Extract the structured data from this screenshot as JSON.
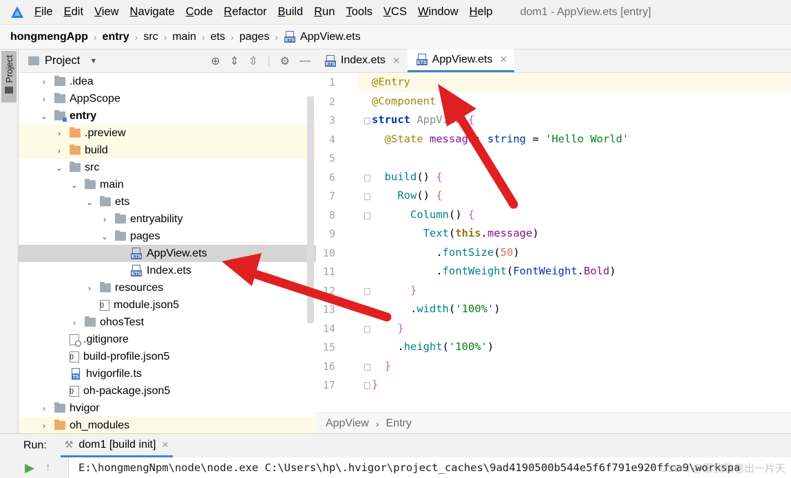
{
  "menubar": {
    "items": [
      {
        "underline": "F",
        "rest": "ile"
      },
      {
        "underline": "E",
        "rest": "dit"
      },
      {
        "underline": "V",
        "rest": "iew"
      },
      {
        "underline": "N",
        "rest": "avigate"
      },
      {
        "underline": "C",
        "rest": "ode"
      },
      {
        "underline": "R",
        "rest": "efactor"
      },
      {
        "underline": "B",
        "rest": "uild"
      },
      {
        "underline": "R",
        "rest": "un"
      },
      {
        "underline": "T",
        "rest": "ools"
      },
      {
        "underline": "V",
        "rest": "CS"
      },
      {
        "underline": "W",
        "rest": "indow"
      },
      {
        "underline": "H",
        "rest": "elp"
      }
    ],
    "window_title": "dom1 - AppView.ets [entry]"
  },
  "breadcrumb": [
    "hongmengApp",
    "entry",
    "src",
    "main",
    "ets",
    "pages",
    "AppView.ets"
  ],
  "stripe": {
    "label": "Project"
  },
  "project_panel": {
    "title": "Project"
  },
  "tree": [
    {
      "label": ".idea",
      "chev": "›",
      "depth": 1,
      "icon": "folder"
    },
    {
      "label": "AppScope",
      "chev": "›",
      "depth": 1,
      "icon": "folder"
    },
    {
      "label": "entry",
      "chev": "⌄",
      "depth": 1,
      "icon": "module",
      "bold": true
    },
    {
      "label": ".preview",
      "chev": "›",
      "depth": 2,
      "icon": "orange",
      "bg": "yellow"
    },
    {
      "label": "build",
      "chev": "›",
      "depth": 2,
      "icon": "orange",
      "bg": "yellow"
    },
    {
      "label": "src",
      "chev": "⌄",
      "depth": 2,
      "icon": "folder"
    },
    {
      "label": "main",
      "chev": "⌄",
      "depth": 3,
      "icon": "folder"
    },
    {
      "label": "ets",
      "chev": "⌄",
      "depth": 4,
      "icon": "folder"
    },
    {
      "label": "entryability",
      "chev": "›",
      "depth": 5,
      "icon": "folder"
    },
    {
      "label": "pages",
      "chev": "⌄",
      "depth": 5,
      "icon": "folder"
    },
    {
      "label": "AppView.ets",
      "chev": "",
      "depth": 6,
      "icon": "ets",
      "bg": "sel"
    },
    {
      "label": "Index.ets",
      "chev": "",
      "depth": 6,
      "icon": "ets"
    },
    {
      "label": "resources",
      "chev": "›",
      "depth": 4,
      "icon": "folder"
    },
    {
      "label": "module.json5",
      "chev": "",
      "depth": 4,
      "icon": "json"
    },
    {
      "label": "ohosTest",
      "chev": "›",
      "depth": 3,
      "icon": "folder"
    },
    {
      "label": ".gitignore",
      "chev": "",
      "depth": 2,
      "icon": "gi"
    },
    {
      "label": "build-profile.json5",
      "chev": "",
      "depth": 2,
      "icon": "json"
    },
    {
      "label": "hvigorfile.ts",
      "chev": "",
      "depth": 2,
      "icon": "ts"
    },
    {
      "label": "oh-package.json5",
      "chev": "",
      "depth": 2,
      "icon": "json"
    },
    {
      "label": "hvigor",
      "chev": "›",
      "depth": 1,
      "icon": "folder"
    },
    {
      "label": "oh_modules",
      "chev": "›",
      "depth": 1,
      "icon": "orange",
      "bg": "yellow"
    }
  ],
  "tabs": [
    {
      "label": "Index.ets",
      "active": false
    },
    {
      "label": "AppView.ets",
      "active": true
    }
  ],
  "code_lines": [
    "<span class=\"an\">@Entry</span>",
    "<span class=\"an\">@Component</span>",
    "<span class=\"kw\">struct</span> <span class=\"dim\">AppView</span> <span class=\"br\">{</span>",
    "  <span class=\"an\">@State</span> <span class=\"prop\">message</span>: <span class=\"type\">string</span> = <span class=\"str\">'Hello World'</span>",
    "",
    "  <span class=\"fn\">build</span>() <span class=\"br\">{</span>",
    "    <span class=\"fn\">Row</span>() <span class=\"br\">{</span>",
    "      <span class=\"fn\">Column</span>() <span class=\"br\">{</span>",
    "        <span class=\"fn\">Text</span>(<span class=\"this\">this</span>.<span class=\"prop\">message</span>)",
    "          .<span class=\"fn\">fontSize</span>(<span class=\"num\">50</span>)",
    "          .<span class=\"fn\">fontWeight</span>(<span class=\"type\">FontWeight</span>.<span class=\"prop\">Bold</span>)",
    "      <span class=\"br\">}</span>",
    "      .<span class=\"fn\">width</span>(<span class=\"str\">'100%'</span>)",
    "    <span class=\"br\">}</span>",
    "    .<span class=\"fn\">height</span>(<span class=\"str\">'100%'</span>)",
    "  <span class=\"br\">}</span>",
    "<span class=\"br\">}</span>"
  ],
  "line_numbers": [
    "1",
    "2",
    "3",
    "4",
    "5",
    "6",
    "7",
    "8",
    "9",
    "10",
    "11",
    "12",
    "13",
    "14",
    "15",
    "16",
    "17"
  ],
  "editor_footer": {
    "path1": "AppView",
    "sep": "›",
    "path2": "Entry"
  },
  "run": {
    "label": "Run:",
    "tab": "dom1 [build init]"
  },
  "console": {
    "text": "E:\\hongmengNpm\\node\\node.exe C:\\Users\\hp\\.hvigor\\project_caches\\9ad4190500b544e5f6f791e920ffca9\\workspa",
    "watermark": "CSDN @跟我联卷出一片天"
  }
}
